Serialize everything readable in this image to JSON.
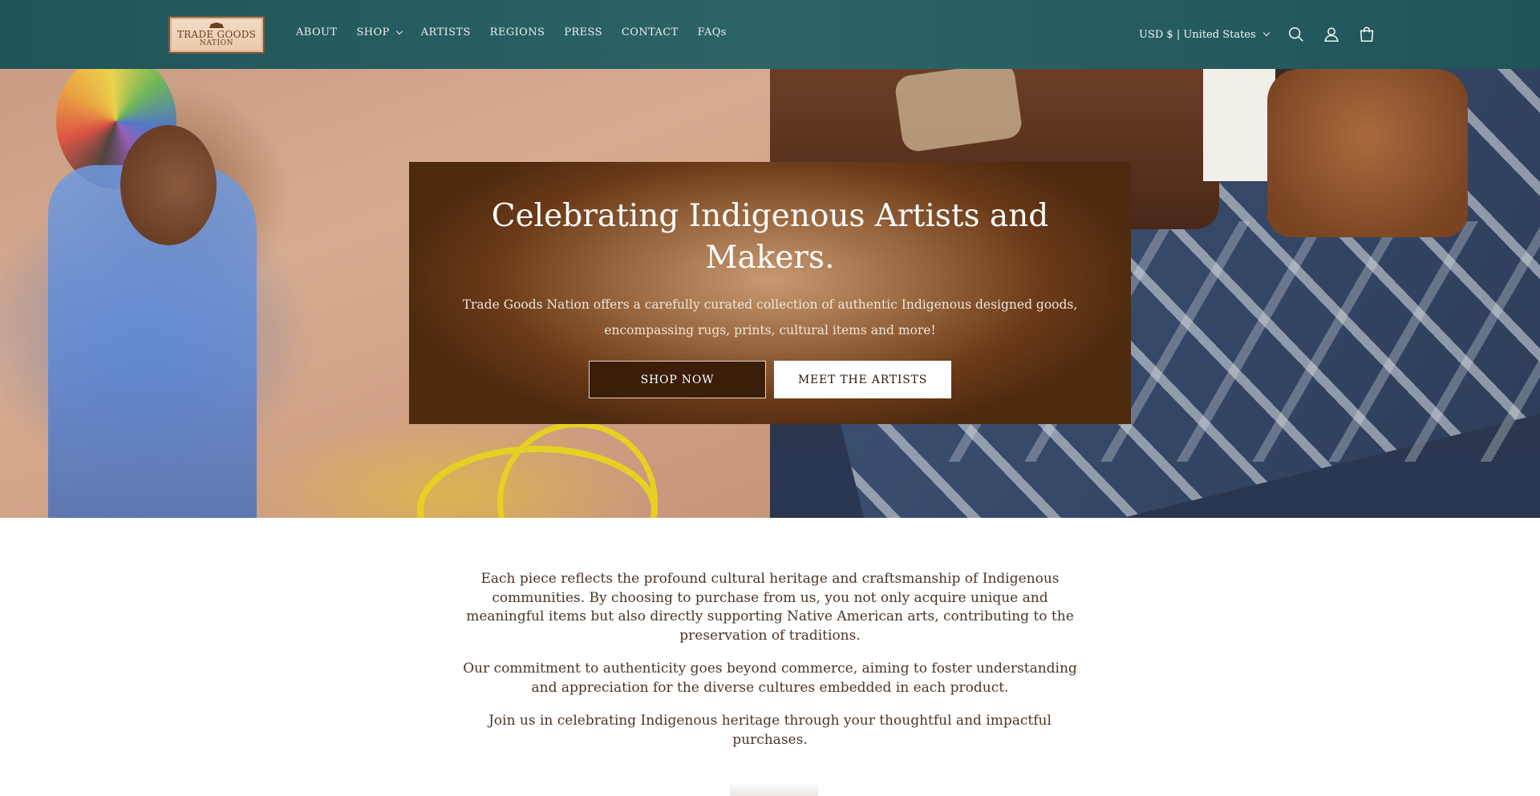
{
  "header": {
    "logo": {
      "line1": "TRADE GOODS",
      "line2": "NATION"
    },
    "nav": [
      {
        "label": "ABOUT",
        "has_dropdown": false
      },
      {
        "label": "SHOP",
        "has_dropdown": true
      },
      {
        "label": "ARTISTS",
        "has_dropdown": false
      },
      {
        "label": "REGIONS",
        "has_dropdown": false
      },
      {
        "label": "PRESS",
        "has_dropdown": false
      },
      {
        "label": "CONTACT",
        "has_dropdown": false
      },
      {
        "label": "FAQs",
        "has_dropdown": false
      }
    ],
    "currency": "USD $ | United States",
    "icons": [
      "search-icon",
      "account-icon",
      "cart-icon"
    ],
    "background_color": "#2a5f63"
  },
  "hero": {
    "title": "Celebrating Indigenous Artists and Makers.",
    "subtitle": "Trade Goods Nation offers a carefully curated collection of authentic Indigenous designed goods, encompassing rugs, prints, cultural items and more!",
    "primary_button": "SHOP NOW",
    "secondary_button": "MEET THE ARTISTS",
    "box_color": "#5a3214"
  },
  "intro": {
    "paragraphs": [
      "Each piece reflects the profound cultural heritage and craftsmanship of Indigenous communities. By choosing to purchase from us, you not only acquire unique and meaningful items but also directly supporting Native American arts, contributing to the preservation of traditions.",
      "Our commitment to authenticity goes beyond commerce, aiming to foster understanding and appreciation for the diverse cultures embedded in each product.",
      "Join us in celebrating Indigenous heritage through your thoughtful and impactful purchases."
    ]
  }
}
